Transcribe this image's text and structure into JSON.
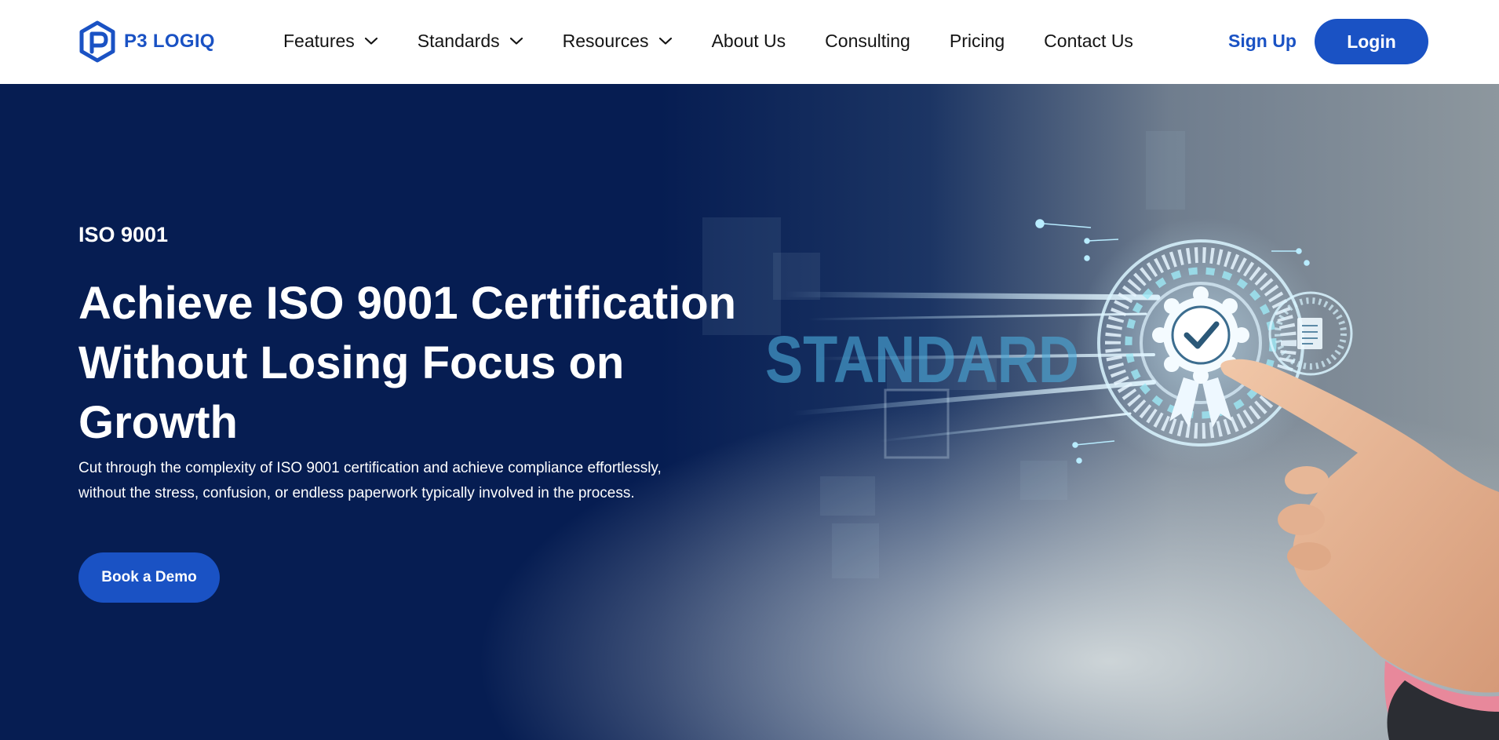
{
  "brand": {
    "name": "P3 LOGIQ",
    "primary_color": "#1a52c4",
    "hero_bg_color": "#061d52",
    "logo_icon": "hexagon-p-logo-icon"
  },
  "nav": {
    "items": [
      {
        "label": "Features",
        "has_dropdown": true,
        "icon": "chevron-down-icon"
      },
      {
        "label": "Standards",
        "has_dropdown": true,
        "icon": "chevron-down-icon"
      },
      {
        "label": "Resources",
        "has_dropdown": true,
        "icon": "chevron-down-icon"
      },
      {
        "label": "About Us",
        "has_dropdown": false
      },
      {
        "label": "Consulting",
        "has_dropdown": false
      },
      {
        "label": "Pricing",
        "has_dropdown": false
      },
      {
        "label": "Contact Us",
        "has_dropdown": false
      }
    ],
    "signup_label": "Sign Up",
    "login_label": "Login"
  },
  "hero": {
    "eyebrow": "ISO 9001",
    "headline": "Achieve ISO 9001 Certification Without Losing Focus on Growth",
    "subtext": "Cut through the complexity of ISO 9001 certification and achieve compliance effortlessly, without the stress, confusion, or endless paperwork typically involved in the process.",
    "cta_label": "Book a Demo",
    "image": {
      "overlay_word": "STANDARD",
      "icon": "certificate-badge-checkmark-icon",
      "secondary_icon": "document-icon",
      "subject": "pointing-hand"
    }
  }
}
